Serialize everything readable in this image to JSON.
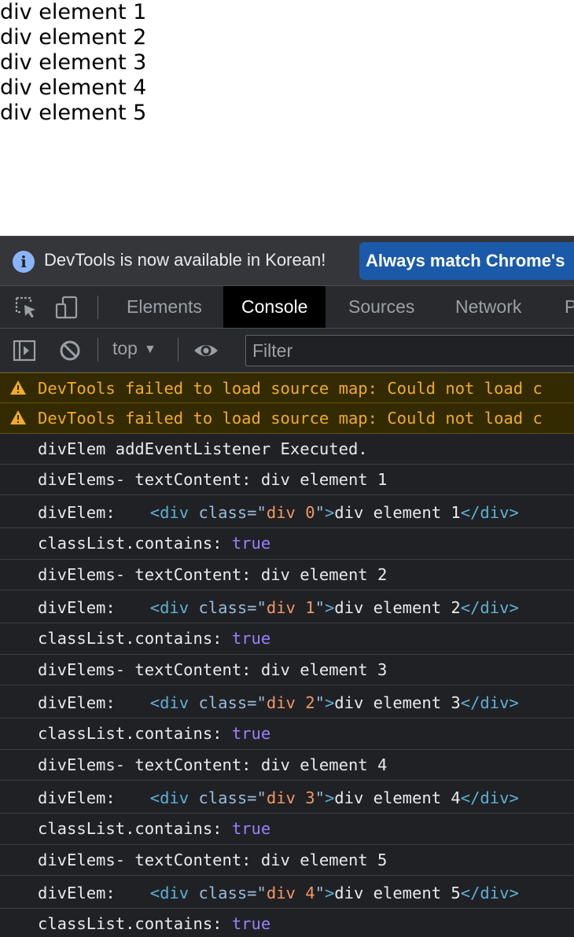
{
  "page": {
    "divs": [
      "div element 1",
      "div element 2",
      "div element 3",
      "div element 4",
      "div element 5"
    ]
  },
  "infobar": {
    "message": "DevTools is now available in Korean!",
    "button_label": "Always match Chrome's"
  },
  "tabs": [
    "Elements",
    "Console",
    "Sources",
    "Network",
    "P"
  ],
  "active_tab": "Console",
  "toolbar": {
    "context": "top",
    "filter_placeholder": "Filter"
  },
  "console": {
    "warnings": [
      "DevTools failed to load source map: Could not load c",
      "DevTools failed to load source map: Could not load c"
    ],
    "executed": "divElem addEventListener Executed.",
    "entries": [
      {
        "text_line": "divElems- textContent: div element 1",
        "elem_label": "divElem:",
        "tag_open": "<div",
        "attr_name": "class=",
        "attr_quote_open": "\"",
        "attr_value": "div 0",
        "attr_quote_close": "\"",
        "tag_close": ">",
        "inner_text": "div element 1",
        "end_tag": "</div>",
        "contains_label": "classList.contains:",
        "contains_value": "true"
      },
      {
        "text_line": "divElems- textContent: div element 2",
        "elem_label": "divElem:",
        "tag_open": "<div",
        "attr_name": "class=",
        "attr_quote_open": "\"",
        "attr_value": "div 1",
        "attr_quote_close": "\"",
        "tag_close": ">",
        "inner_text": "div element 2",
        "end_tag": "</div>",
        "contains_label": "classList.contains:",
        "contains_value": "true"
      },
      {
        "text_line": "divElems- textContent: div element 3",
        "elem_label": "divElem:",
        "tag_open": "<div",
        "attr_name": "class=",
        "attr_quote_open": "\"",
        "attr_value": "div 2",
        "attr_quote_close": "\"",
        "tag_close": ">",
        "inner_text": "div element 3",
        "end_tag": "</div>",
        "contains_label": "classList.contains:",
        "contains_value": "true"
      },
      {
        "text_line": "divElems- textContent: div element 4",
        "elem_label": "divElem:",
        "tag_open": "<div",
        "attr_name": "class=",
        "attr_quote_open": "\"",
        "attr_value": "div 3",
        "attr_quote_close": "\"",
        "tag_close": ">",
        "inner_text": "div element 4",
        "end_tag": "</div>",
        "contains_label": "classList.contains:",
        "contains_value": "true"
      },
      {
        "text_line": "divElems- textContent: div element 5",
        "elem_label": "divElem:",
        "tag_open": "<div",
        "attr_name": "class=",
        "attr_quote_open": "\"",
        "attr_value": "div 4",
        "attr_quote_close": "\"",
        "tag_close": ">",
        "inner_text": "div element 5",
        "end_tag": "</div>",
        "contains_label": "classList.contains:",
        "contains_value": "true"
      }
    ]
  },
  "icons": [
    "inspect-element-icon",
    "device-toolbar-icon",
    "sidebar-toggle-icon",
    "clear-console-icon",
    "eye-icon",
    "info-icon",
    "warning-icon"
  ],
  "colors": {
    "devtools_bg": "#202124",
    "warning_bg": "#332a00",
    "warning_text": "#f2ab26",
    "info_button": "#1a5aa8",
    "html_tag": "#5db0d7",
    "attr_value": "#f29766",
    "boolean": "#9980ff"
  }
}
